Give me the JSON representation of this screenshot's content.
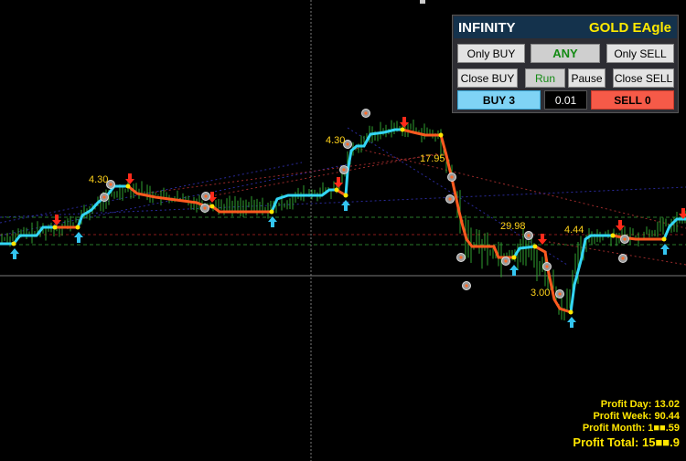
{
  "panel": {
    "title": "INFINITY",
    "brand": "GOLD EAgle",
    "buttons": {
      "only_buy": "Only BUY",
      "any": "ANY",
      "only_sell": "Only SELL",
      "close_buy": "Close BUY",
      "run": "Run",
      "pause": "Pause",
      "close_sell": "Close SELL",
      "buy": "BUY 3",
      "sell": "SELL 0"
    },
    "lot_value": "0.01"
  },
  "profits": {
    "day": "Profit Day: 13.02",
    "week": "Profit Week: 90.44",
    "month": "Profit Month: 1■■.59",
    "total": "Profit Total: 15■■.9"
  },
  "chart_labels": {
    "l1": "4.30",
    "l2": "4.30",
    "l3": "17.95",
    "l4": "29.98",
    "l5": "4.44",
    "l6": "3.00"
  },
  "colors": {
    "background": "#000000",
    "up_line": "#33d6f5",
    "down_line": "#ff5a1f",
    "candles": "#2fa12f",
    "buy_arrow": "#33c5f0",
    "sell_arrow": "#ff2a1a",
    "label": "#ffd21a",
    "panel_header": "#14324c"
  }
}
